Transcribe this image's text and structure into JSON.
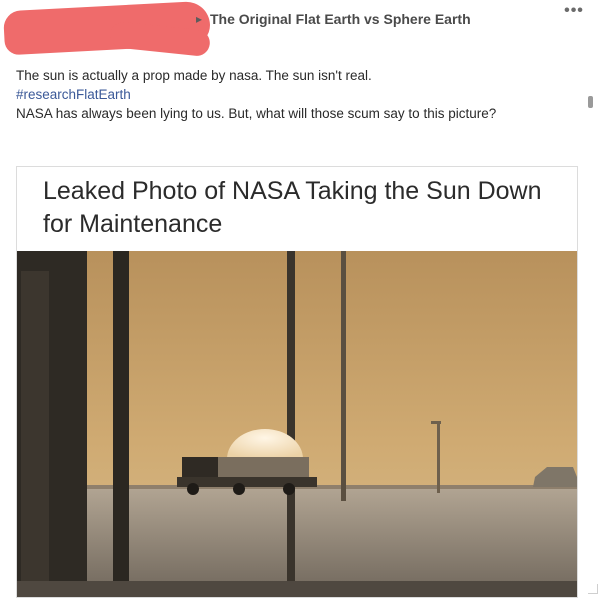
{
  "post": {
    "group_name": "The Original Flat Earth vs Sphere Earth",
    "more_label": "•••",
    "arrow": "▸",
    "text_line1": "The sun is actually a prop made by nasa. The sun isn't real.",
    "hashtag": "#researchFlatEarth",
    "text_line2": "NASA has always been lying to us. But, what will those scum say to this picture?"
  },
  "card": {
    "headline": "Leaked Photo of NASA Taking the Sun Down for Maintenance"
  },
  "colors": {
    "redaction": "#ef6b6b",
    "sky": "#c9a46a",
    "sun_dome": "#f3e3c8",
    "link": "#3b5998"
  }
}
